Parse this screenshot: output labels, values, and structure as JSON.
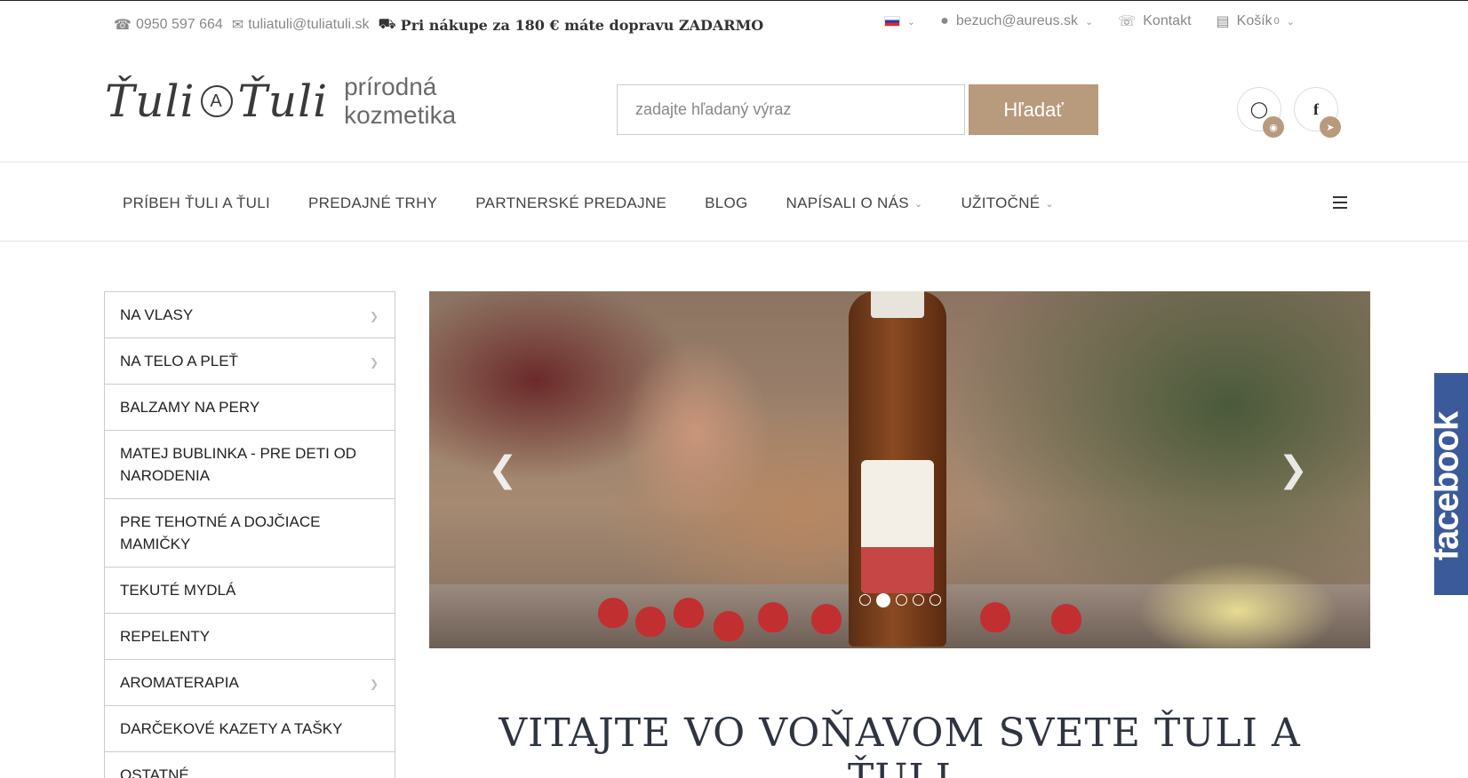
{
  "topbar": {
    "phone": "0950 597 664",
    "email": "tuliatuli@tuliatuli.sk",
    "promo": "Pri nákupe za 180 € máte dopravu ZADARMO",
    "user": "bezuch@aureus.sk",
    "contact": "Kontakt",
    "cart_label": "Košík",
    "cart_count": "0"
  },
  "logo": {
    "brand_left": "Ťuli",
    "brand_mid": "A",
    "brand_right": "Ťuli",
    "tag_line1": "prírodná",
    "tag_line2": "kozmetika"
  },
  "search": {
    "placeholder": "zadajte hľadaný výraz",
    "button": "Hľadať"
  },
  "nav": {
    "items": [
      "PRÍBEH ŤULI A ŤULI",
      "PREDAJNÉ TRHY",
      "PARTNERSKÉ PREDAJNE",
      "BLOG",
      "NAPÍSALI O NÁS",
      "UŽITOČNÉ"
    ]
  },
  "sidebar": {
    "items": [
      {
        "label": "NA VLASY",
        "has_sub": true
      },
      {
        "label": "NA TELO A PLEŤ",
        "has_sub": true
      },
      {
        "label": "BALZAMY NA PERY",
        "has_sub": false
      },
      {
        "label": "MATEJ BUBLINKA - PRE DETI OD NARODENIA",
        "has_sub": false
      },
      {
        "label": "PRE TEHOTNÉ A DOJČIACE MAMIČKY",
        "has_sub": false
      },
      {
        "label": "TEKUTÉ MYDLÁ",
        "has_sub": false
      },
      {
        "label": "REPELENTY",
        "has_sub": false
      },
      {
        "label": "AROMATERAPIA",
        "has_sub": true
      },
      {
        "label": "DARČEKOVÉ KAZETY A TAŠKY",
        "has_sub": false
      },
      {
        "label": "OSTATNÉ",
        "has_sub": false
      }
    ]
  },
  "slider": {
    "slide_count": 5,
    "active_index": 1
  },
  "welcome": {
    "title": "VITAJTE VO VOŇAVOM SVETE ŤULI A ŤULI"
  },
  "fbtab": {
    "label": "facebook"
  },
  "colors": {
    "accent": "#b89a7c",
    "facebook": "#3b5a9a"
  }
}
